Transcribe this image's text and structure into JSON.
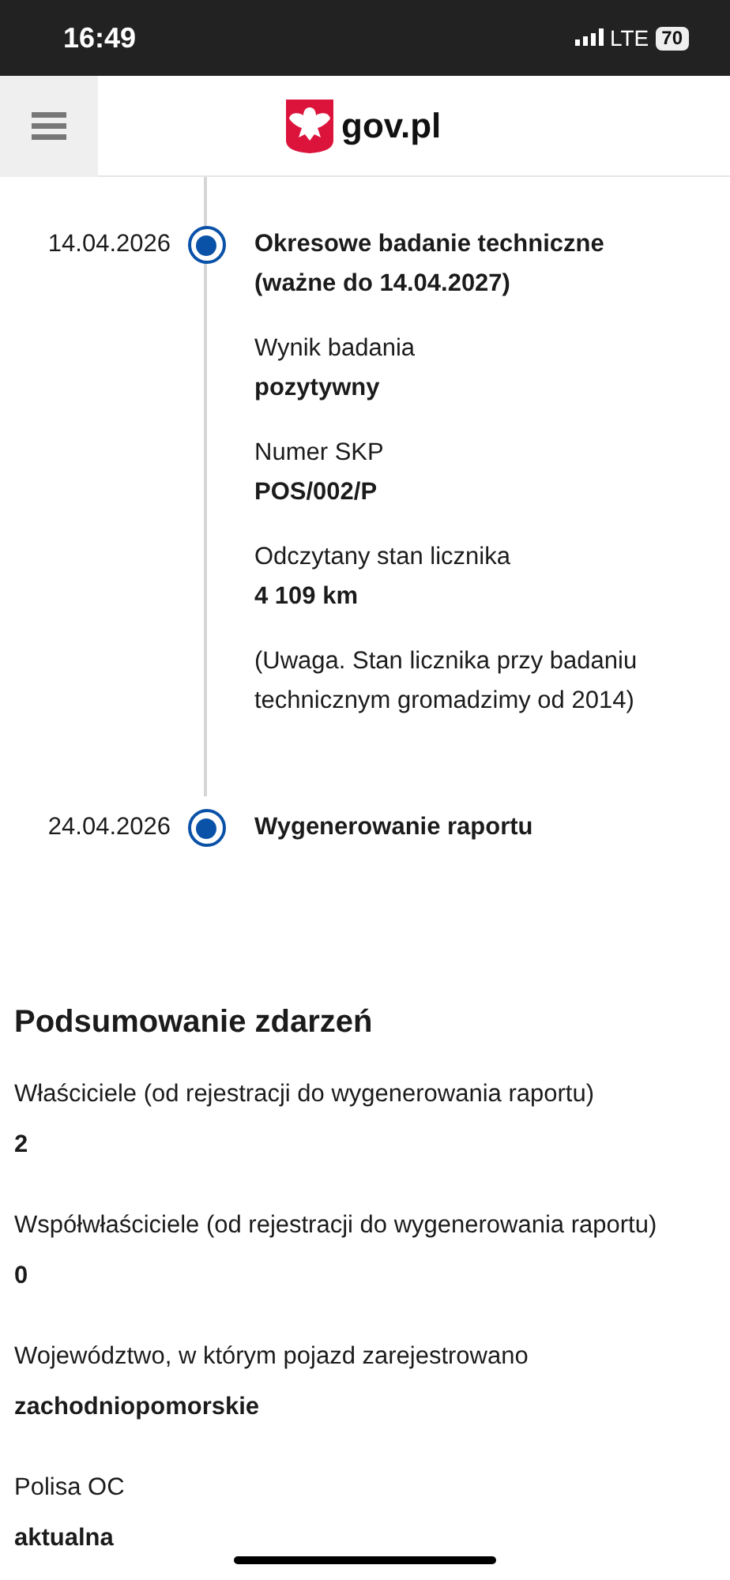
{
  "status_bar": {
    "time": "16:49",
    "network": "LTE",
    "battery": "70"
  },
  "header": {
    "logo_text": "gov.pl"
  },
  "timeline": [
    {
      "date": "14.04.2026",
      "title": "Okresowe badanie techniczne (ważne do 14.04.2027)",
      "details": [
        {
          "label": "Wynik badania",
          "value": "pozytywny"
        },
        {
          "label": "Numer SKP",
          "value": "POS/002/P"
        },
        {
          "label": "Odczytany stan licznika",
          "value": "4 109 km"
        }
      ],
      "note": "(Uwaga. Stan licznika przy badaniu technicznym gromadzimy od 2014)"
    },
    {
      "date": "24.04.2026",
      "title": "Wygenerowanie raportu"
    }
  ],
  "summary": {
    "title": "Podsumowanie zdarzeń",
    "items": [
      {
        "label": "Właściciele (od rejestracji do wygenerowania raportu)",
        "value": "2"
      },
      {
        "label": "Współwłaściciele (od rejestracji do wygenerowania raportu)",
        "value": "0"
      },
      {
        "label": "Województwo, w którym pojazd zarejestrowano",
        "value": "zachodniopomorskie"
      },
      {
        "label": "Polisa OC",
        "value": "aktualna"
      }
    ]
  }
}
